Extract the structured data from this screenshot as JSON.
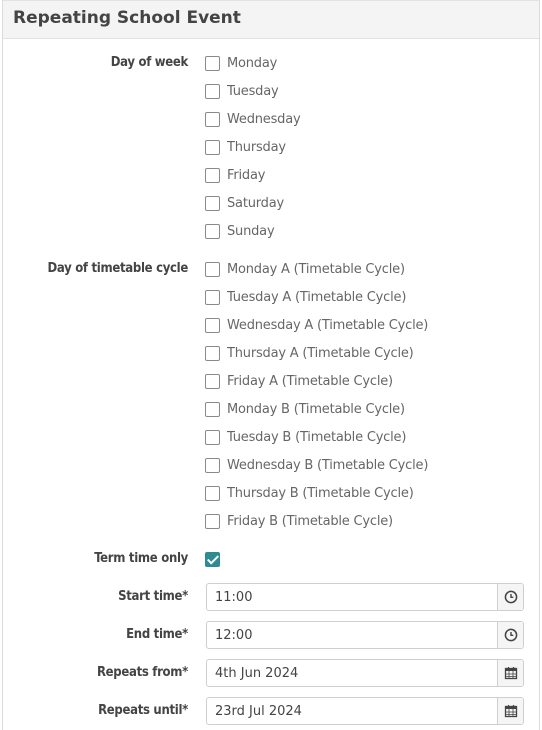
{
  "panel": {
    "title": "Repeating School Event"
  },
  "day_of_week": {
    "label": "Day of week",
    "options": [
      "Monday",
      "Tuesday",
      "Wednesday",
      "Thursday",
      "Friday",
      "Saturday",
      "Sunday"
    ]
  },
  "day_of_timetable_cycle": {
    "label": "Day of timetable cycle",
    "options": [
      "Monday A (Timetable Cycle)",
      "Tuesday A (Timetable Cycle)",
      "Wednesday A (Timetable Cycle)",
      "Thursday A (Timetable Cycle)",
      "Friday A (Timetable Cycle)",
      "Monday B (Timetable Cycle)",
      "Tuesday B (Timetable Cycle)",
      "Wednesday B (Timetable Cycle)",
      "Thursday B (Timetable Cycle)",
      "Friday B (Timetable Cycle)"
    ]
  },
  "term_time_only": {
    "label": "Term time only",
    "checked": true
  },
  "start_time": {
    "label": "Start time*",
    "value": "11:00",
    "icon": "clock-icon"
  },
  "end_time": {
    "label": "End time*",
    "value": "12:00",
    "icon": "clock-icon"
  },
  "repeats_from": {
    "label": "Repeats from*",
    "value": "4th Jun 2024",
    "icon": "calendar-icon"
  },
  "repeats_until": {
    "label": "Repeats until*",
    "value": "23rd Jul 2024",
    "icon": "calendar-icon"
  },
  "colors": {
    "accent": "#2e8a93",
    "header_bg": "#f4f4f4"
  }
}
